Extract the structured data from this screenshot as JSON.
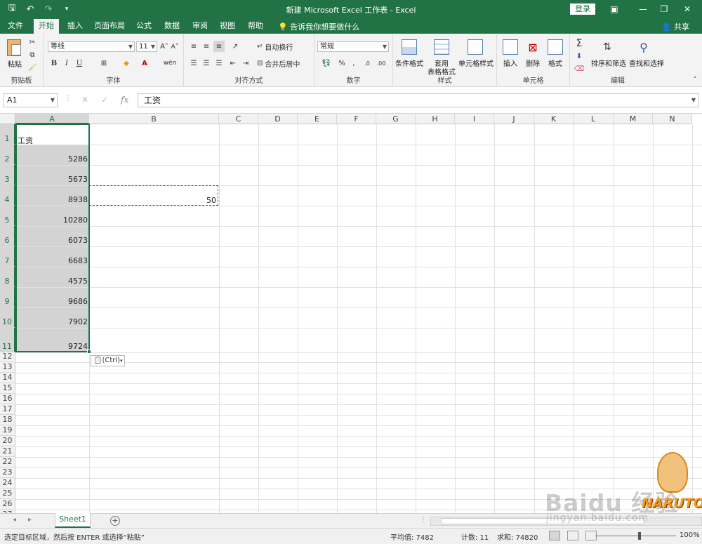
{
  "titlebar": {
    "title": "新建 Microsoft Excel 工作表  -  Excel",
    "login": "登录"
  },
  "tabs": [
    {
      "label": "文件"
    },
    {
      "label": "开始"
    },
    {
      "label": "插入"
    },
    {
      "label": "页面布局"
    },
    {
      "label": "公式"
    },
    {
      "label": "数据"
    },
    {
      "label": "审阅"
    },
    {
      "label": "视图"
    },
    {
      "label": "帮助"
    }
  ],
  "tellme": "告诉我你想要做什么",
  "share": "共享",
  "ribbon": {
    "clipboard": {
      "paste": "粘贴",
      "group": "剪贴板"
    },
    "font": {
      "name": "等线",
      "size": "11",
      "group": "字体",
      "grow": "A˄",
      "shrink": "A˅",
      "bold": "B",
      "italic": "I",
      "underline": "U",
      "pinyin": "wén"
    },
    "align": {
      "wrap": "自动换行",
      "merge": "合并后居中",
      "group": "对齐方式"
    },
    "number": {
      "format": "常规",
      "group": "数字",
      "percent": "%",
      "comma": ","
    },
    "styles": {
      "cond": "条件格式",
      "table1": "套用",
      "table2": "表格格式",
      "cell": "单元格样式",
      "group": "样式"
    },
    "cells": {
      "insert": "插入",
      "delete": "删除",
      "format": "格式",
      "group": "单元格"
    },
    "editing": {
      "sum": "Σ",
      "sort": "排序和筛选",
      "find": "查找和选择",
      "group": "编辑"
    }
  },
  "formula_bar": {
    "namebox": "A1",
    "cancel": "✕",
    "enter": "✓",
    "fx": "fx",
    "value": "工资"
  },
  "columns": [
    "A",
    "B",
    "C",
    "D",
    "E",
    "F",
    "G",
    "H",
    "I",
    "J",
    "K",
    "L",
    "M",
    "N"
  ],
  "rows": [
    "1",
    "2",
    "3",
    "4",
    "5",
    "6",
    "7",
    "8",
    "9",
    "10",
    "11",
    "12",
    "13",
    "14",
    "15",
    "16",
    "17",
    "18",
    "19",
    "20",
    "21",
    "22",
    "23",
    "24",
    "25",
    "26",
    "27"
  ],
  "cells": {
    "A1": "工资",
    "A_values": [
      "5286",
      "5673",
      "8938",
      "10280",
      "6073",
      "6683",
      "4575",
      "9686",
      "7902",
      "9724"
    ],
    "B4": "50"
  },
  "paste_tag": "(Ctrl)",
  "sheet": {
    "name": "Sheet1"
  },
  "status": {
    "message": "选定目标区域，然后按 ENTER 或选择“粘贴”",
    "average": "平均值: 7482",
    "count": "计数: 11",
    "sum": "求和: 74820",
    "zoom": "100%"
  },
  "watermark": {
    "brand": "Baidu 经验",
    "url": "jingyan.baidu.com",
    "logo": "NARUTO"
  }
}
